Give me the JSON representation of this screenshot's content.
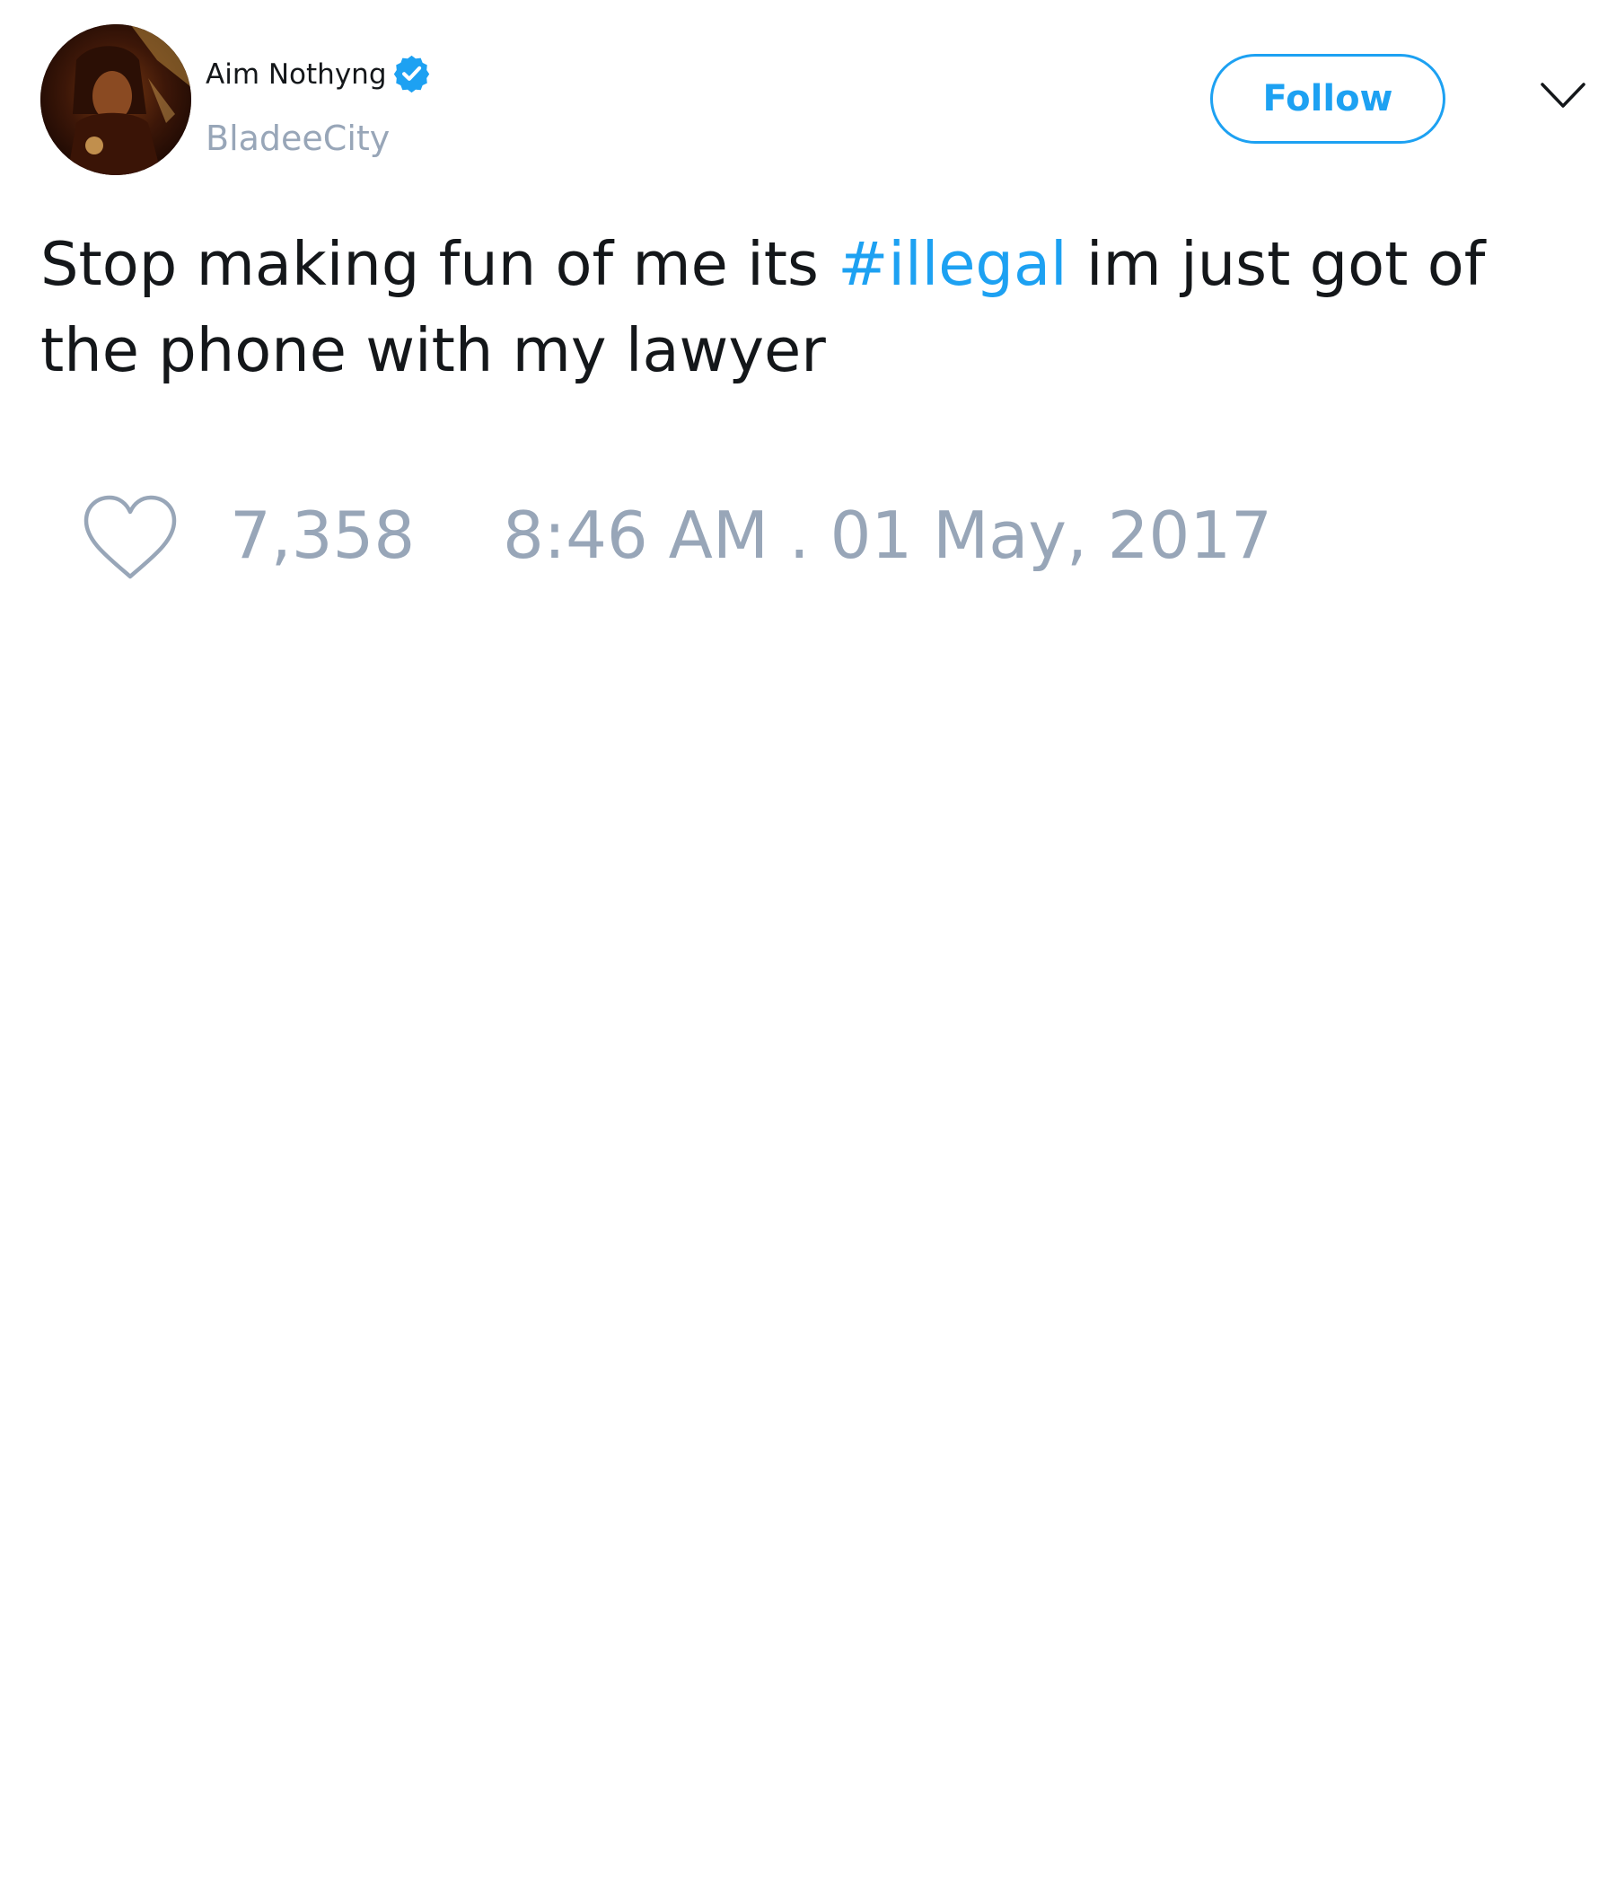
{
  "user": {
    "display_name": "Aim Nothyng",
    "handle": "BladeeCity",
    "verified": true
  },
  "actions": {
    "follow_label": "Follow"
  },
  "tweet": {
    "text_before": "Stop making fun of me its ",
    "hashtag": "#illegal",
    "text_after": " im just got of the phone with my lawyer"
  },
  "stats": {
    "like_count": "7,358",
    "timestamp": "8:46 AM . 01 May, 2017"
  },
  "icons": {
    "verified": "verified-badge-icon",
    "caret": "chevron-down-icon",
    "like": "heart-icon"
  },
  "colors": {
    "accent": "#1da1f2",
    "secondary_text": "#98a6b8",
    "primary_text": "#14171a"
  }
}
